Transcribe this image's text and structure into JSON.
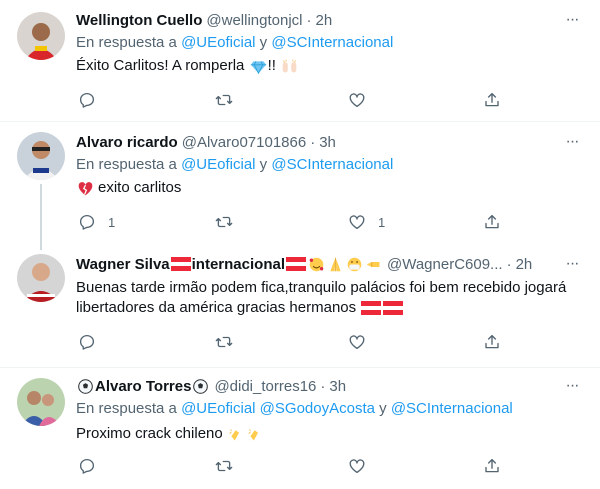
{
  "tweets": [
    {
      "name": "Wellington Cuello",
      "handle": "@wellingtonjcl",
      "time": "2h",
      "reply_prefix": "En respuesta a ",
      "mention_1": "@UEoficial",
      "reply_join": " y ",
      "mention_2": "@SCInternacional",
      "text_a": "Éxito Carlitos! A romperla ",
      "text_b": "!! ",
      "emoji": [
        "gem-stone",
        "raising-hands"
      ],
      "reply_count": "",
      "like_count": ""
    },
    {
      "name": "Alvaro ricardo",
      "handle": "@Alvaro07101866",
      "time": "3h",
      "reply_prefix": "En respuesta a ",
      "mention_1": "@UEoficial",
      "reply_join": " y ",
      "mention_2": "@SCInternacional",
      "text": "exito carlitos",
      "emoji": [
        "broken-heart"
      ],
      "reply_count": "1",
      "like_count": "1"
    },
    {
      "name_a": "Wagner Silva ",
      "name_b": "internacional",
      "handle": "@WagnerC609...",
      "time": "2h",
      "text": "Buenas tarde irmão podem fica,tranquilo palácios foi bem recebido jogará libertadores da américa gracias hermanos ",
      "emoji": [
        "flag-austria",
        "smiling-face-with-hearts",
        "folded-hands",
        "face-with-medical-mask",
        "backhand-index-left"
      ],
      "reply_count": "",
      "like_count": ""
    },
    {
      "name_a": " Alvaro Torres ",
      "handle": "@didi_torres16",
      "time": "3h",
      "reply_prefix": "En respuesta a ",
      "mention_1": "@UEoficial",
      "reply_space": " ",
      "mention_2": "@SGodoyAcosta",
      "reply_join": " y ",
      "mention_3": "@SCInternacional",
      "text": "Proximo crack chileno ",
      "emoji": [
        "soccer-ball",
        "clapping-hands"
      ],
      "reply_count": "",
      "like_count": ""
    }
  ],
  "dot": "·",
  "more": "···",
  "colors": {
    "link": "#1d9bf0",
    "secondary": "#536471",
    "divider": "#eff3f4",
    "thread": "#cfd9de"
  }
}
